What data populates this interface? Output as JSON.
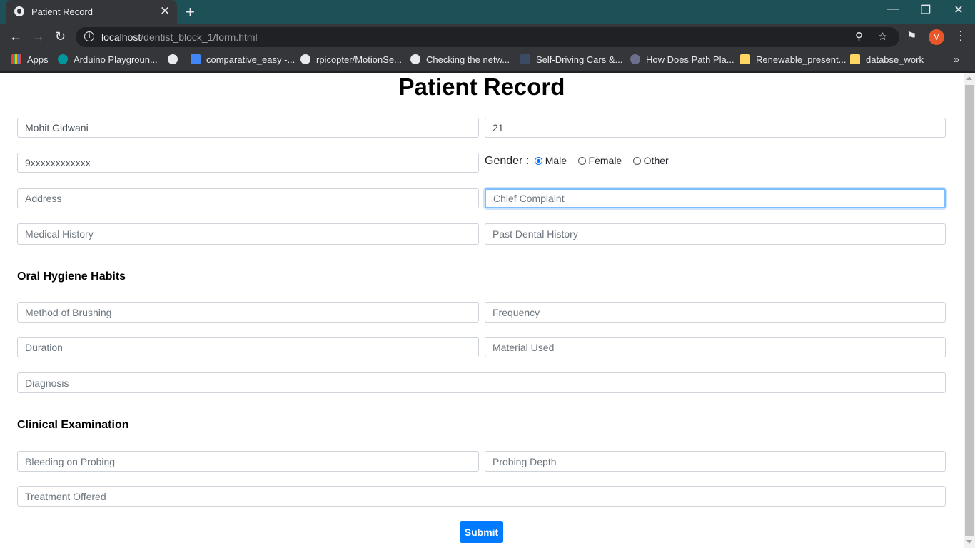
{
  "browser": {
    "tab_title": "Patient Record",
    "tab_close": "✕",
    "new_tab": "+",
    "url_host": "localhost",
    "url_path": "/dentist_block_1/form.html",
    "avatar_letter": "M",
    "bookmarks": [
      {
        "label": "Apps",
        "color": "#ea4335"
      },
      {
        "label": "Arduino Playgroun...",
        "color": "#00979d"
      },
      {
        "label": "",
        "color": "#e8eaed"
      },
      {
        "label": "comparative_easy -...",
        "color": "#4285f4"
      },
      {
        "label": "rpicopter/MotionSe...",
        "color": "#e8eaed"
      },
      {
        "label": "Checking the netw...",
        "color": "#e8eaed"
      },
      {
        "label": "Self-Driving Cars &...",
        "color": "#3b4b63"
      },
      {
        "label": "How Does Path Pla...",
        "color": "#6b6f8a"
      },
      {
        "label": "Renewable_present...",
        "color": "#fdd663"
      },
      {
        "label": "databse_work",
        "color": "#fdd663"
      }
    ],
    "bookmarks_more": "»"
  },
  "form": {
    "title": "Patient Record",
    "name_value": "Mohit Gidwani",
    "age_value": "21",
    "phone_value": "9xxxxxxxxxxxx",
    "gender_label": "Gender :",
    "gender_options": [
      "Male",
      "Female",
      "Other"
    ],
    "gender_selected": "Male",
    "address_placeholder": "Address",
    "chief_complaint_placeholder": "Chief Complaint",
    "medical_history_placeholder": "Medical History",
    "past_dental_history_placeholder": "Past Dental History",
    "oral_hygiene_heading": "Oral Hygiene Habits",
    "method_of_brushing_placeholder": "Method of Brushing",
    "frequency_placeholder": "Frequency",
    "duration_placeholder": "Duration",
    "material_used_placeholder": "Material Used",
    "diagnosis_placeholder": "Diagnosis",
    "clinical_heading": "Clinical Examination",
    "bleeding_placeholder": "Bleeding on Probing",
    "probing_depth_placeholder": "Probing Depth",
    "treatment_placeholder": "Treatment Offered",
    "submit_label": "Submit"
  }
}
